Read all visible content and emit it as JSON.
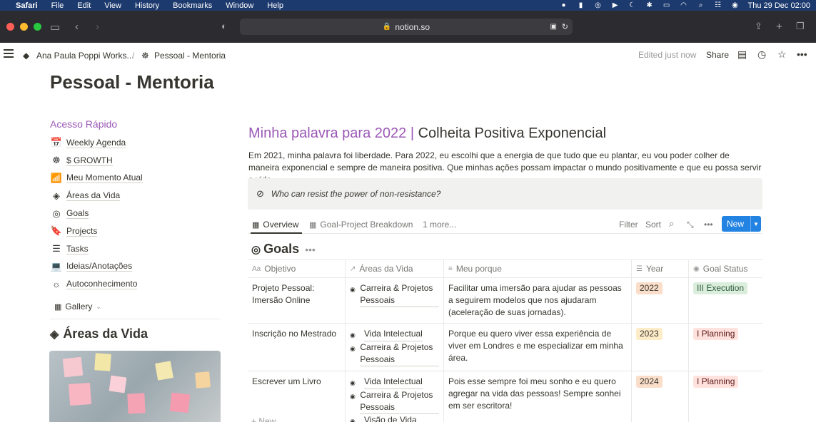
{
  "menubar": {
    "app": "Safari",
    "items": [
      "File",
      "Edit",
      "View",
      "History",
      "Bookmarks",
      "Window",
      "Help"
    ],
    "clock": "Thu 29 Dec  02:00"
  },
  "browser": {
    "url": "notion.so"
  },
  "notion_top": {
    "workspace": "Ana Paula Poppi Works...",
    "separator": "/",
    "page": "Pessoal - Mentoria",
    "edited": "Edited just now",
    "share": "Share"
  },
  "page_title": "Pessoal - Mentoria",
  "left": {
    "heading": "Acesso Rápido",
    "items": [
      {
        "icon": "📅",
        "label": "Weekly Agenda"
      },
      {
        "icon": "☸",
        "label": "$ GROWTH"
      },
      {
        "icon": "📶",
        "label": "Meu Momento Atual"
      },
      {
        "icon": "◈",
        "label": "Áreas da Vida"
      },
      {
        "icon": "◎",
        "label": "Goals"
      },
      {
        "icon": "🔖",
        "label": "Projects"
      },
      {
        "icon": "☰",
        "label": "Tasks"
      },
      {
        "icon": "💻",
        "label": "Ideias/Anotações"
      },
      {
        "icon": "☼",
        "label": "Autoconhecimento"
      }
    ],
    "gallery": "Gallery",
    "areas_title": "Áreas da Vida"
  },
  "main": {
    "word_title_part1": "Minha palavra para 2022 |",
    "word_title_part2": " Colheita Positiva Exponencial",
    "intro": "Em 2021, minha palavra foi liberdade. Para 2022, eu escolhi que a energia de que tudo que eu plantar, eu vou poder colher de maneira exponencial e sempre de maneira positiva. Que minhas ações possam impactar o mundo positivamente e que eu possa servir a vida.",
    "callout": "Who can resist the power of non-resistance?",
    "views": {
      "tab1": "Overview",
      "tab2": "Goal-Project Breakdown",
      "more": "1 more...",
      "filter": "Filter",
      "sort": "Sort",
      "new": "New"
    },
    "db_title": "Goals",
    "columns": {
      "objetivo": "Objetivo",
      "areas": "Áreas da Vida",
      "porque": "Meu porque",
      "year": "Year",
      "status": "Goal Status"
    },
    "rows": [
      {
        "objetivo": "Projeto Pessoal: Imersão Online",
        "areas": [
          "Carreira & Projetos Pessoais"
        ],
        "porque": " Facilitar uma imersão para ajudar as pessoas a seguirem modelos que nos ajudaram (aceleração de suas jornadas).",
        "year": "2022",
        "status": "III Execution"
      },
      {
        "objetivo": "Inscrição no Mestrado",
        "areas": [
          "Vida Intelectual",
          "Carreira & Projetos Pessoais"
        ],
        "porque": "Porque eu quero viver essa experiência de viver em Londres e me especializar em minha área.",
        "year": "2023",
        "status": "I Planning"
      },
      {
        "objetivo": "Escrever um Livro",
        "areas": [
          "Vida Intelectual",
          "Carreira & Projetos Pessoais",
          "Visão de Vida"
        ],
        "porque": "Pois esse sempre foi meu sonho e eu quero agregar na vida das pessoas! Sempre sonhei em ser escritora!",
        "year": "2024",
        "status": "I Planning"
      }
    ],
    "add_new": "+ New"
  }
}
